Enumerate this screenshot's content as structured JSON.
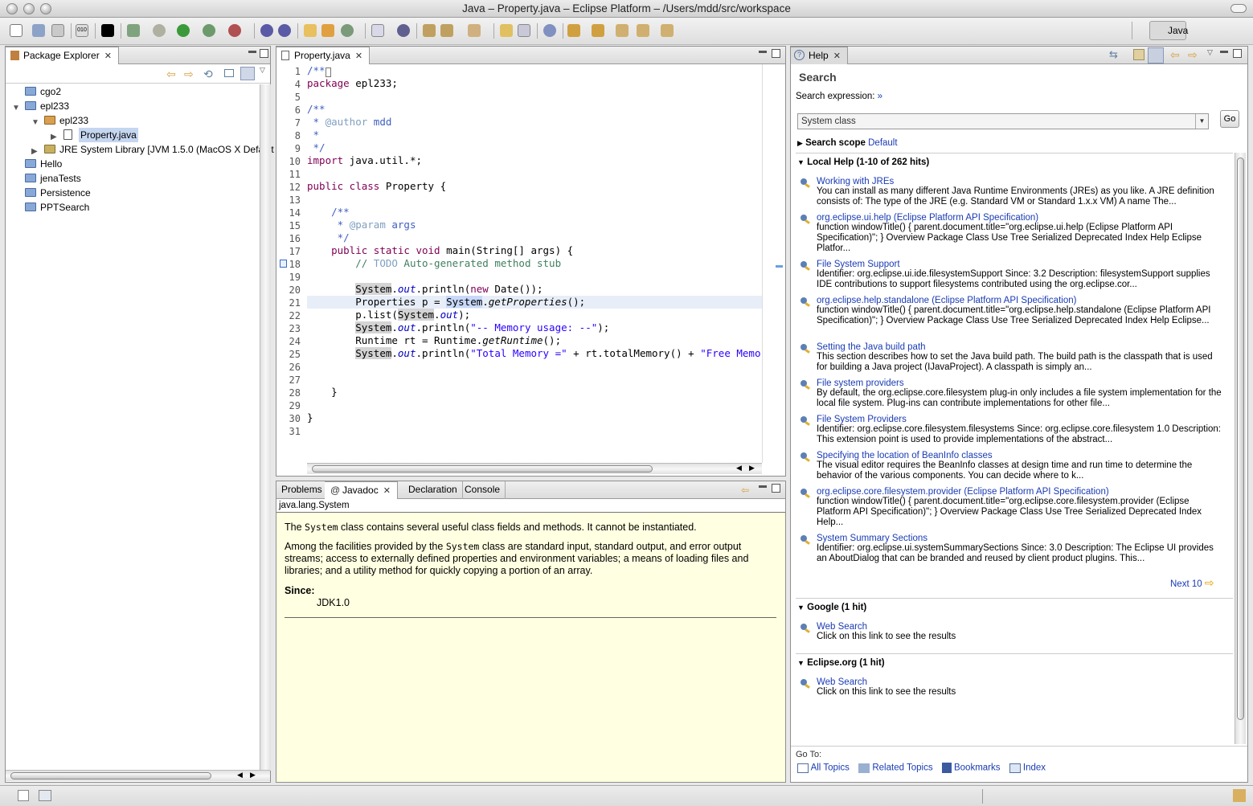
{
  "window": {
    "title": "Java – Property.java – Eclipse Platform – /Users/mdd/src/workspace"
  },
  "perspective": {
    "label": "Java"
  },
  "package_explorer": {
    "tab_label": "Package Explorer",
    "items": [
      {
        "label": "cgo2",
        "level": 0,
        "expanded": false
      },
      {
        "label": "epl233",
        "level": 0,
        "expanded": true
      },
      {
        "label": "epl233",
        "level": 1,
        "expanded": true
      },
      {
        "label": "Property.java",
        "level": 2,
        "selected": true
      },
      {
        "label": "JRE System Library [JVM 1.5.0 (MacOS X Default",
        "level": 1
      },
      {
        "label": "Hello",
        "level": 0
      },
      {
        "label": "jenaTests",
        "level": 0
      },
      {
        "label": "Persistence",
        "level": 0
      },
      {
        "label": "PPTSearch",
        "level": 0
      }
    ]
  },
  "editor": {
    "tab_label": "Property.java",
    "line_numbers": [
      "1",
      "4",
      "5",
      "6",
      "7",
      "8",
      "9",
      "10",
      "11",
      "12",
      "13",
      "14",
      "15",
      "16",
      "17",
      "18",
      "19",
      "20",
      "21",
      "22",
      "23",
      "24",
      "25",
      "26",
      "27",
      "28",
      "29",
      "30",
      "31"
    ]
  },
  "bottom_panel": {
    "tabs": [
      "Problems",
      "Javadoc",
      "Declaration",
      "Console"
    ],
    "active_tab": "Javadoc",
    "javadoc_header": "java.lang.System",
    "para1_pre": "The ",
    "para1_code": "System",
    "para1_post": " class contains several useful class fields and methods. It cannot be instantiated.",
    "para2_pre": "Among the facilities provided by the ",
    "para2_code": "System",
    "para2_post": " class are standard input, standard output, and error output streams; access to externally defined properties and environment variables; a means of loading files and libraries; and a utility method for quickly copying a portion of an array.",
    "since_label": "Since:",
    "since_value": "JDK1.0"
  },
  "help": {
    "tab_label": "Help",
    "heading": "Search",
    "search_expression_label": "Search expression:",
    "search_expression_link": "»",
    "search_value": "System class",
    "go_button": "Go",
    "scope_label": "Search scope",
    "scope_value": "Default",
    "local_help_header": "Local Help (1-10 of 262 hits)",
    "results": [
      {
        "title": "Working with JREs",
        "desc": "You can install as many different Java Runtime Environments (JREs) as you like. A JRE definition consists of: The type of the JRE (e.g. Standard VM or Standard 1.x.x VM) A name The..."
      },
      {
        "title": "org.eclipse.ui.help (Eclipse Platform API Specification)",
        "desc": "function windowTitle() { parent.document.title=\"org.eclipse.ui.help (Eclipse Platform API Specification)\"; } Overview Package Class Use Tree Serialized Deprecated Index Help Eclipse Platfor..."
      },
      {
        "title": "File System Support",
        "desc": "Identifier: org.eclipse.ui.ide.filesystemSupport Since: 3.2 Description: filesystemSupport supplies IDE contributions to support filesystems contributed using the org.eclipse.cor..."
      },
      {
        "title": "org.eclipse.help.standalone (Eclipse Platform API Specification)",
        "desc": "function windowTitle() { parent.document.title=\"org.eclipse.help.standalone (Eclipse Platform API Specification)\"; } Overview Package Class Use Tree Serialized Deprecated Index Help Eclipse..."
      },
      {
        "title": "Setting the Java build path",
        "desc": "This section describes how to set the Java build path. The build path is the classpath that is used for building a Java project (IJavaProject). A classpath is simply an..."
      },
      {
        "title": "File system providers",
        "desc": "By default, the org.eclipse.core.filesystem plug-in only includes a file system implementation for the local file system. Plug-ins can contribute implementations for other file..."
      },
      {
        "title": "File System Providers",
        "desc": "Identifier: org.eclipse.core.filesystem.filesystems Since: org.eclipse.core.filesystem 1.0 Description: This extension point is used to provide implementations of the abstract..."
      },
      {
        "title": "Specifying the location of BeanInfo classes",
        "desc": "The visual editor requires the BeanInfo classes at design time and run time to determine the behavior of the various components. You can decide where to k..."
      },
      {
        "title": "org.eclipse.core.filesystem.provider (Eclipse Platform API Specification)",
        "desc": "function windowTitle() { parent.document.title=\"org.eclipse.core.filesystem.provider (Eclipse Platform API Specification)\"; } Overview Package Class Use Tree Serialized Deprecated Index Help..."
      },
      {
        "title": "System Summary Sections",
        "desc": "Identifier: org.eclipse.ui.systemSummarySections Since: 3.0 Description: The Eclipse UI provides an AboutDialog that can be branded and reused by client product plugins. This..."
      }
    ],
    "next_label": "Next 10",
    "google_header": "Google (1 hit)",
    "google_result": {
      "title": "Web Search",
      "desc": "Click on this link to see the results"
    },
    "eclipse_header": "Eclipse.org  (1 hit)",
    "eclipse_result": {
      "title": "Web Search",
      "desc": "Click on this link to see the results"
    },
    "goto_label": "Go To:",
    "goto_links": [
      "All Topics",
      "Related Topics",
      "Bookmarks",
      "Index"
    ]
  }
}
